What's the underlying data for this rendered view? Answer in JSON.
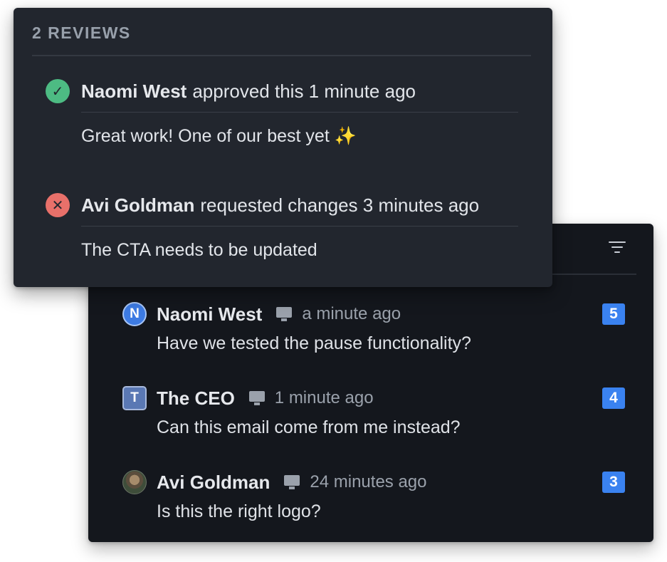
{
  "reviews": {
    "title": "2 REVIEWS",
    "items": [
      {
        "author": "Naomi West",
        "action": "approved this 1 minute ago",
        "status": "approved",
        "status_icon": "checkmark-icon",
        "status_glyph": "✓",
        "comment": "Great work! One of our best yet ✨"
      },
      {
        "author": "Avi Goldman",
        "action": "requested changes 3 minutes ago",
        "status": "changes-requested",
        "status_icon": "close-icon",
        "status_glyph": "✕",
        "comment": "The CTA needs to be updated"
      }
    ]
  },
  "comments": {
    "filter_icon": "filter-icon",
    "items": [
      {
        "avatar": "N",
        "author": "Naomi West",
        "device_icon": "desktop-icon",
        "time": "a minute ago",
        "body": "Have we tested the pause functionality?",
        "badge": "5"
      },
      {
        "avatar": "T",
        "author": "The CEO",
        "device_icon": "desktop-icon",
        "time": "1 minute ago",
        "body": "Can this email come from me instead?",
        "badge": "4"
      },
      {
        "avatar": "",
        "author": "Avi Goldman",
        "device_icon": "desktop-icon",
        "time": "24 minutes ago",
        "body": "Is this the right logo?",
        "badge": "3"
      }
    ]
  },
  "colors": {
    "comments_bg": "#14171d",
    "reviews_bg": "#22262e",
    "approved": "#4dbb83",
    "changes": "#e8706a",
    "badge": "#3a82f0"
  }
}
